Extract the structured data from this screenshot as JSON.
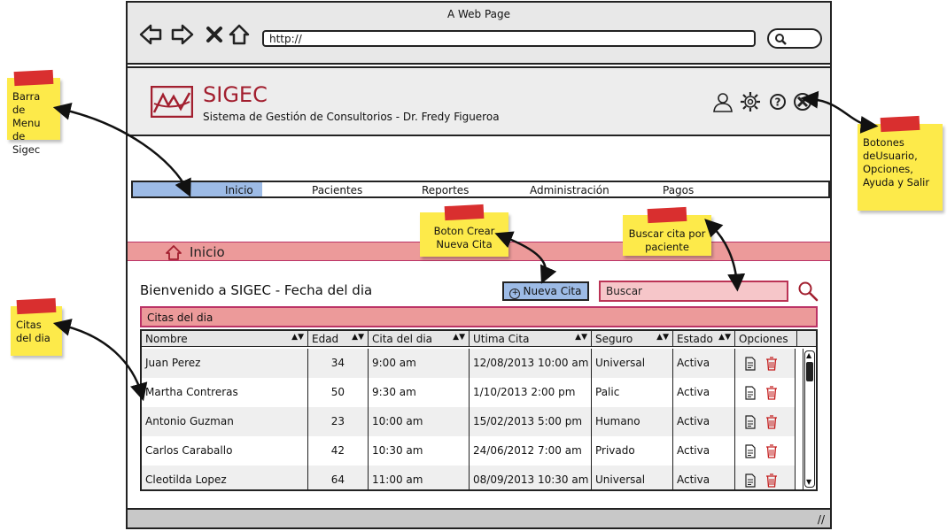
{
  "browser": {
    "title": "A Web Page",
    "url": "http://"
  },
  "app": {
    "brand": "SIGEC",
    "subtitle": "Sistema de Gestión de Consultorios - Dr. Fredy Figueroa",
    "accent_color": "#a21f2f"
  },
  "menu": {
    "items": [
      {
        "label": "Inicio",
        "active": true
      },
      {
        "label": "Pacientes"
      },
      {
        "label": "Reportes"
      },
      {
        "label": "Administración"
      },
      {
        "label": "Pagos"
      }
    ]
  },
  "section": {
    "title": "Inicio"
  },
  "content": {
    "welcome": "Bienvenido a SIGEC - Fecha del dia",
    "new_button": "Nueva Cita",
    "search_value": "Buscar",
    "caption": "Citas del dia"
  },
  "table": {
    "columns": [
      "Nombre",
      "Edad",
      "Cita del dia",
      "Utima Cita",
      "Seguro",
      "Estado",
      "Opciones"
    ],
    "rows": [
      [
        "Juan Perez",
        "34",
        "9:00 am",
        "12/08/2013 10:00 am",
        "Universal",
        "Activa"
      ],
      [
        "Martha Contreras",
        "50",
        "9:30 am",
        "1/10/2013 2:00 pm",
        "Palic",
        "Activa"
      ],
      [
        "Antonio Guzman",
        "23",
        "10:00 am",
        "15/02/2013 5:00 pm",
        "Humano",
        "Activa"
      ],
      [
        "Carlos Caraballo",
        "42",
        "10:30 am",
        "24/06/2012 7:00 am",
        "Privado",
        "Activa"
      ],
      [
        "Cleotilda Lopez",
        "64",
        "11:00 am",
        "08/09/2013 10:30 am",
        "Universal",
        "Activa"
      ]
    ]
  },
  "notes": {
    "menu": "Barra de Menu de Sigec",
    "buttons": "Botones deUsuario, Opciones, Ayuda y Salir",
    "new": "Boton Crear Nueva Cita",
    "search": "Buscar cita por paciente",
    "list": "Citas del dia"
  },
  "icons": [
    "back-icon",
    "forward-icon",
    "stop-icon",
    "home-icon",
    "user-icon",
    "gear-icon",
    "help-icon",
    "close-icon",
    "search-icon",
    "document-icon",
    "trash-icon"
  ]
}
